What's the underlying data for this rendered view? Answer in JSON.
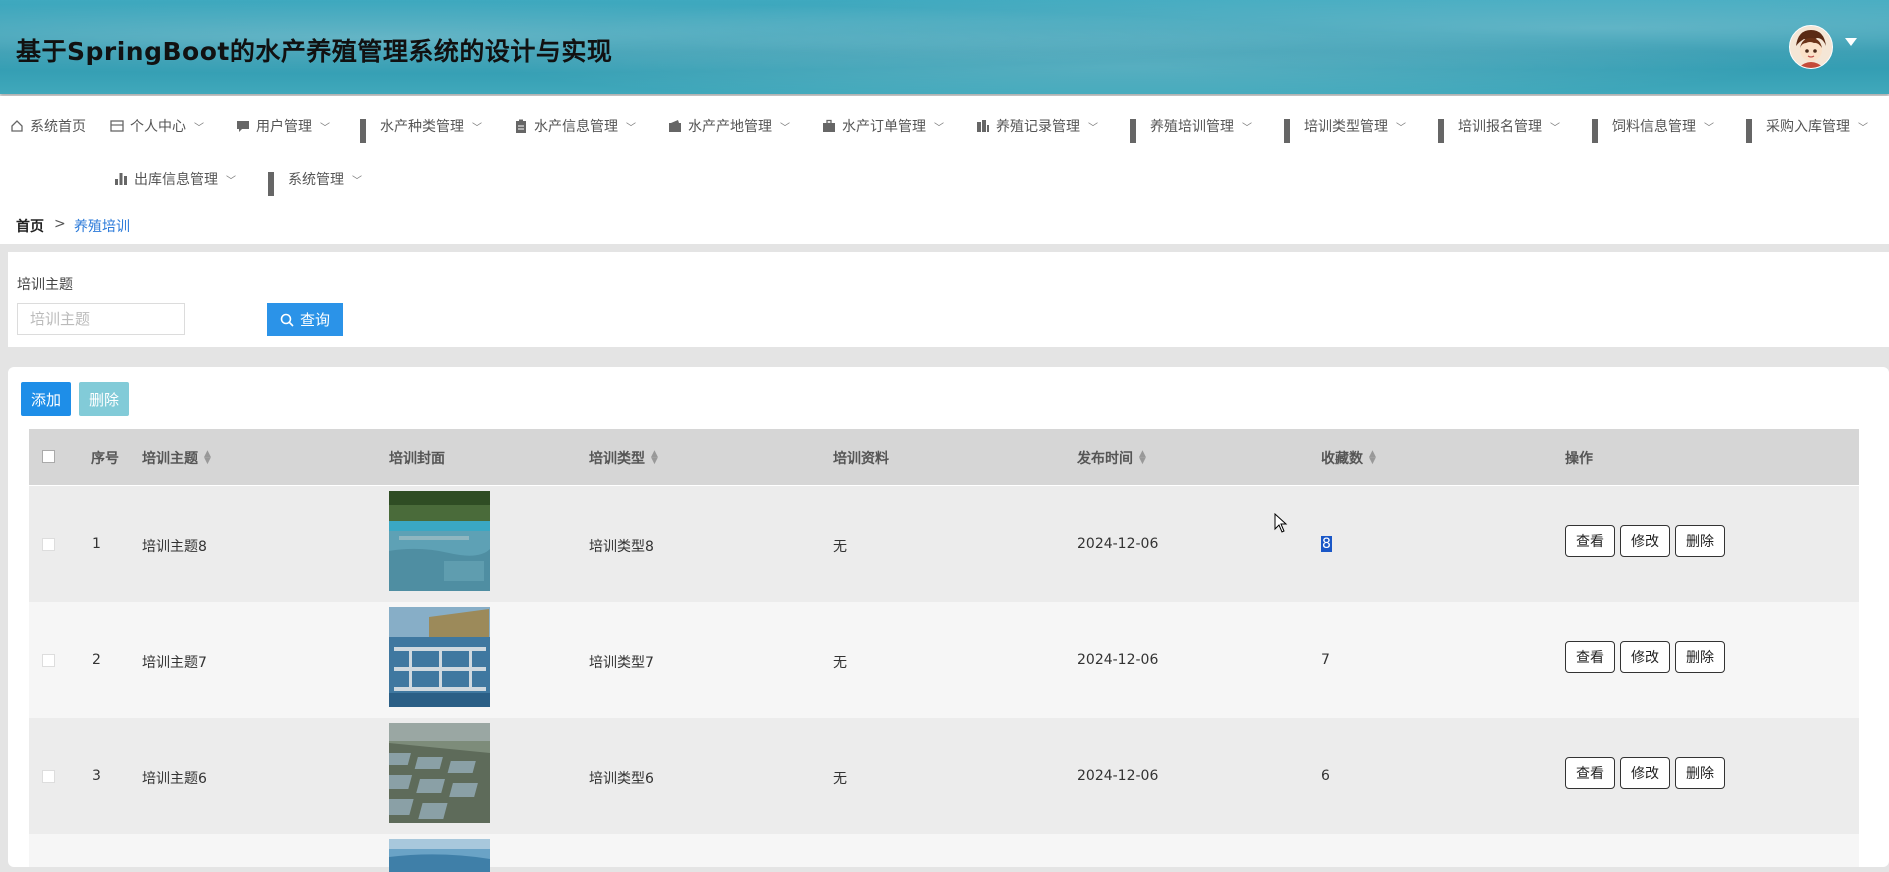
{
  "header": {
    "title": "基于SpringBoot的水产养殖管理系统的设计与实现"
  },
  "nav": {
    "items": [
      {
        "label": "系统首页",
        "icon": "home-icon",
        "chevron": false
      },
      {
        "label": "个人中心",
        "icon": "card-icon",
        "chevron": true
      },
      {
        "label": "用户管理",
        "icon": "chat-icon",
        "chevron": true
      },
      {
        "label": "水产种类管理",
        "icon": "grid-icon",
        "chevron": true
      },
      {
        "label": "水产信息管理",
        "icon": "clipboard-icon",
        "chevron": true
      },
      {
        "label": "水产产地管理",
        "icon": "wallet-icon",
        "chevron": true
      },
      {
        "label": "水产订单管理",
        "icon": "briefcase-icon",
        "chevron": true
      },
      {
        "label": "养殖记录管理",
        "icon": "building-icon",
        "chevron": true
      },
      {
        "label": "养殖培训管理",
        "icon": "grid-icon",
        "chevron": true
      },
      {
        "label": "培训类型管理",
        "icon": "grid-icon",
        "chevron": true
      },
      {
        "label": "培训报名管理",
        "icon": "grid-icon",
        "chevron": true
      },
      {
        "label": "饲料信息管理",
        "icon": "grid-icon",
        "chevron": true
      },
      {
        "label": "采购入库管理",
        "icon": "grid-icon",
        "chevron": true
      },
      {
        "label": "出库信息管理",
        "icon": "bar-chart-icon",
        "chevron": true
      },
      {
        "label": "系统管理",
        "icon": "grid-icon",
        "chevron": true
      }
    ]
  },
  "breadcrumb": {
    "home": "首页",
    "separator": ">",
    "current": "养殖培训"
  },
  "search": {
    "label": "培训主题",
    "placeholder": "培训主题",
    "value": "",
    "button": "查询"
  },
  "actions": {
    "add": "添加",
    "delete": "删除"
  },
  "table": {
    "headers": {
      "index": "序号",
      "topic": "培训主题",
      "cover": "培训封面",
      "type": "培训类型",
      "material": "培训资料",
      "publish_time": "发布时间",
      "favorites": "收藏数",
      "operation": "操作"
    },
    "rows": [
      {
        "index": "1",
        "topic": "培训主题8",
        "type": "培训类型8",
        "material": "无",
        "publish_time": "2024-12-06",
        "favorites": "8",
        "cover": "aquaculture pond with nets"
      },
      {
        "index": "2",
        "topic": "培训主题7",
        "type": "培训类型7",
        "material": "无",
        "publish_time": "2024-12-06",
        "favorites": "7",
        "cover": "floating fish cages"
      },
      {
        "index": "3",
        "topic": "培训主题6",
        "type": "培训类型6",
        "material": "无",
        "publish_time": "2024-12-06",
        "favorites": "6",
        "cover": "aerial view of fish ponds"
      }
    ],
    "row_buttons": {
      "view": "查看",
      "edit": "修改",
      "delete": "删除"
    }
  },
  "colors": {
    "primary": "#1e8ee8",
    "disabled": "#82cbd8",
    "link": "#2b7ad9",
    "header_bg": "#2c97ae"
  }
}
